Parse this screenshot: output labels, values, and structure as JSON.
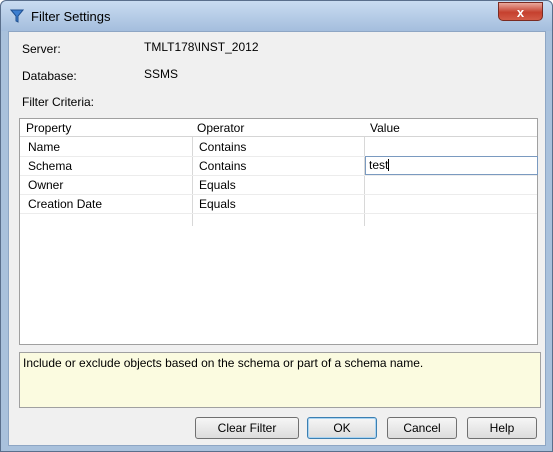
{
  "window": {
    "title": "Filter Settings",
    "close_label": "x"
  },
  "fields": {
    "server_label": "Server:",
    "server_value": "TMLT178\\INST_2012",
    "database_label": "Database:",
    "database_value": "SSMS",
    "criteria_label": "Filter Criteria:"
  },
  "grid": {
    "headers": [
      "Property",
      "Operator",
      "Value"
    ],
    "rows": [
      {
        "property": "Name",
        "operator": "Contains",
        "value": ""
      },
      {
        "property": "Schema",
        "operator": "Contains",
        "value": "test"
      },
      {
        "property": "Owner",
        "operator": "Equals",
        "value": ""
      },
      {
        "property": "Creation Date",
        "operator": "Equals",
        "value": ""
      }
    ]
  },
  "description": "Include or exclude objects based on the schema or part of a schema name.",
  "buttons": {
    "clear_filter": "Clear Filter",
    "ok": "OK",
    "cancel": "Cancel",
    "help": "Help"
  },
  "colors": {
    "title_bg": "#a4bedd",
    "client_bg": "#f0f0f0",
    "description_bg": "#fbfbe0",
    "close_red": "#c5402e"
  }
}
